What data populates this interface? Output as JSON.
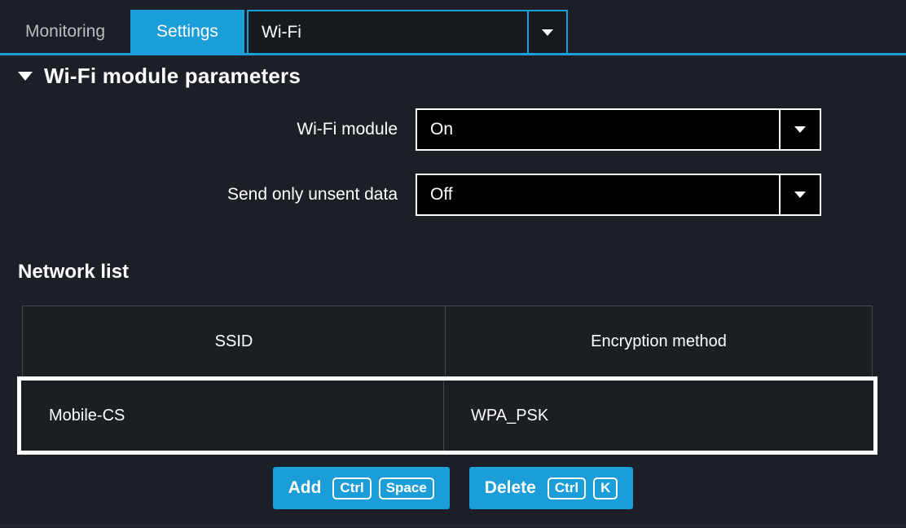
{
  "tabs": {
    "monitoring_label": "Monitoring",
    "settings_label": "Settings",
    "page_select": {
      "value": "Wi-Fi",
      "arrow_icon": "chevron-down-icon"
    }
  },
  "section": {
    "collapse_icon": "triangle-down-icon",
    "title": "Wi-Fi module parameters"
  },
  "fields": [
    {
      "label": "Wi-Fi module",
      "value": "On",
      "arrow_icon": "chevron-down-icon"
    },
    {
      "label": "Send only unsent data",
      "value": "Off",
      "arrow_icon": "chevron-down-icon"
    }
  ],
  "network_list": {
    "title": "Network list",
    "columns": [
      "SSID",
      "Encryption method"
    ],
    "rows": [
      {
        "ssid": "Mobile-CS",
        "encryption": "WPA_PSK",
        "selected": true
      }
    ]
  },
  "buttons": [
    {
      "label": "Add",
      "keys": [
        "Ctrl",
        "Space"
      ]
    },
    {
      "label": "Delete",
      "keys": [
        "Ctrl",
        "K"
      ]
    }
  ],
  "colors": {
    "accent": "#1b9dd9",
    "background": "#1c1f25",
    "field_background": "#000000",
    "selection_border": "#ffffff",
    "table_border": "#43464c",
    "inactive_tab_text": "#b9bcc0"
  }
}
